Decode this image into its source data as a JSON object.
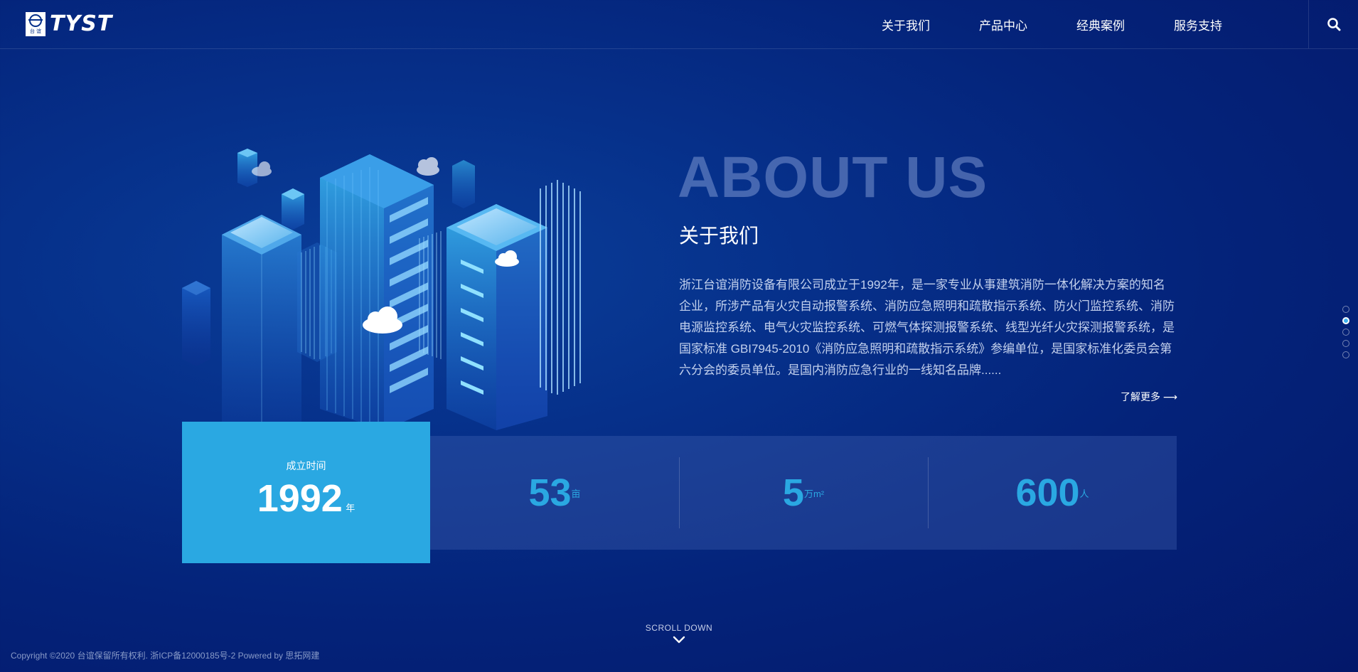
{
  "header": {
    "logo_text": "TYST",
    "logo_emblem_text": "台 谊",
    "nav": [
      {
        "label": "关于我们"
      },
      {
        "label": "产品中心"
      },
      {
        "label": "经典案例"
      },
      {
        "label": "服务支持"
      }
    ],
    "search_icon": "search-icon"
  },
  "about": {
    "title_en": "ABOUT US",
    "title_cn": "关于我们",
    "description": "浙江台谊消防设备有限公司成立于1992年，是一家专业从事建筑消防一体化解决方案的知名企业，所涉产品有火灾自动报警系统、消防应急照明和疏散指示系统、防火门监控系统、消防电源监控系统、电气火灾监控系统、可燃气体探测报警系统、线型光纤火灾探测报警系统，是国家标准 GBI7945-2010《消防应急照明和疏散指示系统》参编单位，是国家标准化委员会第六分会的委员单位。是国内消防应急行业的一线知名品牌......",
    "learn_more": "了解更多 ⟶"
  },
  "stats": {
    "founded": {
      "label": "成立时间",
      "value": "1992",
      "unit": "年"
    },
    "items": [
      {
        "value": "53",
        "unit": "亩"
      },
      {
        "value": "5",
        "unit": "万m²"
      },
      {
        "value": "600",
        "unit": "人"
      }
    ]
  },
  "pagination": {
    "count": 5,
    "active_index": 1
  },
  "scroll_down": "SCROLL DOWN",
  "footer": "Copyright ©2020 台谊保留所有权利. 浙ICP备12000185号-2 Powered by 思拓网建",
  "colors": {
    "accent": "#2aa8e2",
    "background": "#04237a"
  }
}
